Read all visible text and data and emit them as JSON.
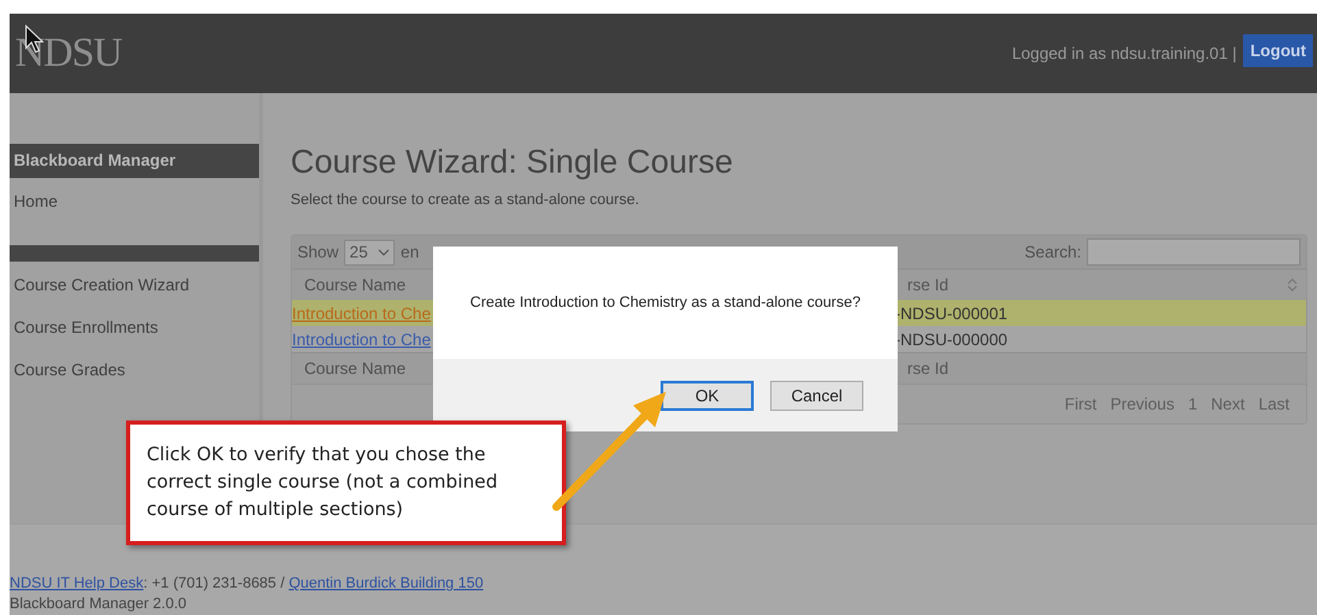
{
  "header": {
    "logo": "NDSU",
    "user_text": "Logged in as ndsu.training.01 |",
    "logout": "Logout"
  },
  "sidebar": {
    "groups": [
      {
        "heading": "Blackboard Manager",
        "items": [
          "Home"
        ]
      },
      {
        "items": [
          "Course Creation Wizard",
          "Course Enrollments",
          "Course Grades"
        ]
      }
    ]
  },
  "main": {
    "title": "Course Wizard: Single Course",
    "subtitle": "Select the course to create as a stand-alone course.",
    "table": {
      "show_label": "Show",
      "page_size": "25",
      "entries_label": "en",
      "search_label": "Search:",
      "columns": [
        "Course Name",
        "rse Id"
      ],
      "rows": [
        {
          "name": "Introduction to Che",
          "id": "-NDSU-000001",
          "selected": true
        },
        {
          "name": "Introduction to Che",
          "id": "-NDSU-000000",
          "selected": false
        }
      ],
      "footer_columns": [
        "Course Name",
        "rse Id"
      ],
      "pagination": [
        "First",
        "Previous",
        "1",
        "Next",
        "Last"
      ]
    }
  },
  "dialog": {
    "message": "Create Introduction to Chemistry as a stand-alone course?",
    "buttons": [
      {
        "label": "OK",
        "focused": true
      },
      {
        "label": "Cancel",
        "focused": false
      }
    ]
  },
  "callout": {
    "text": "Click OK to verify that you chose the correct single course (not a combined course of multiple sections)"
  },
  "footer": {
    "help_link": "NDSU IT Help Desk",
    "contact": ": +1 (701) 231-8685 /",
    "location_link": "Quentin Burdick Building 150",
    "version": "Blackboard Manager 2.0.0"
  }
}
